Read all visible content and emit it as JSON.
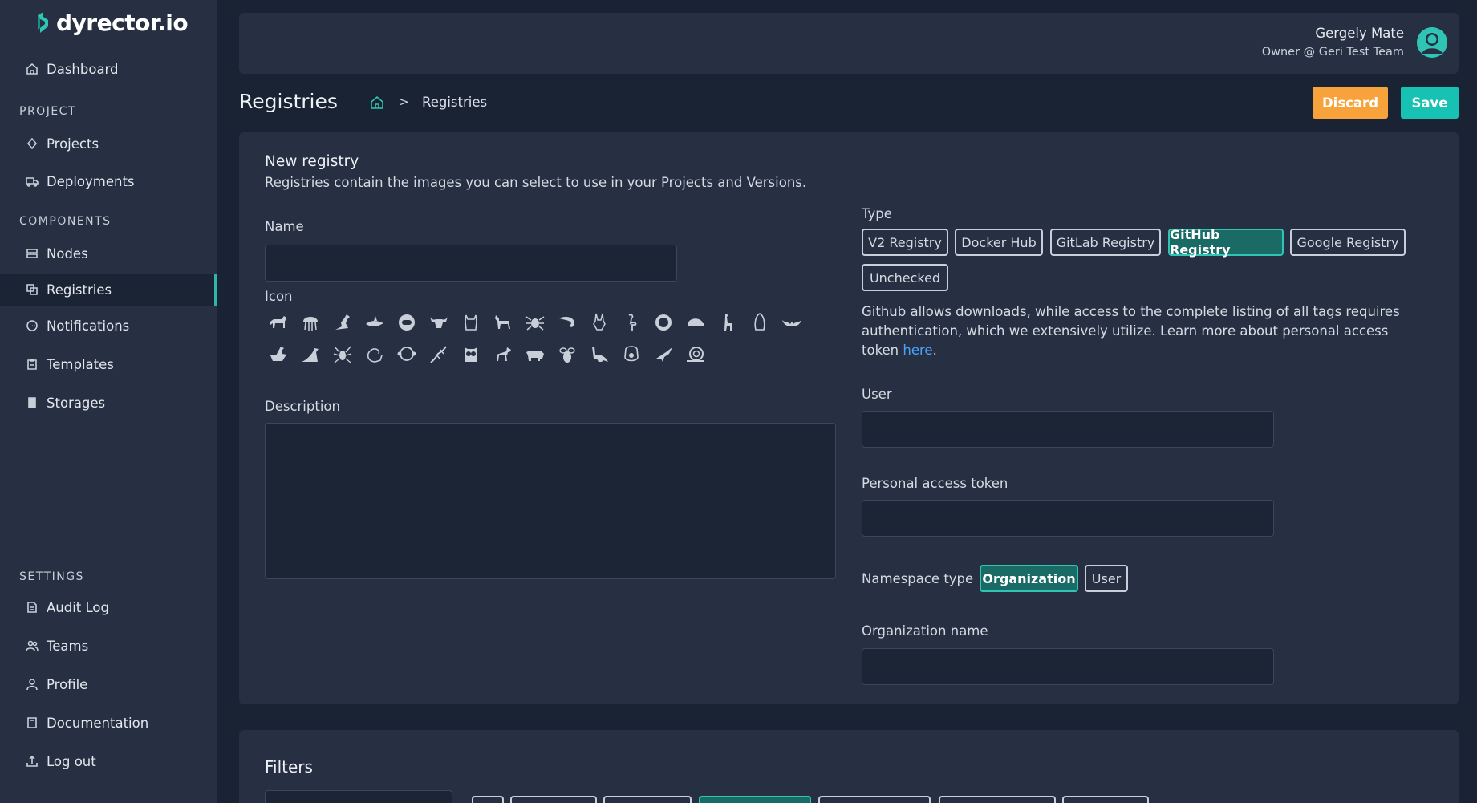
{
  "brand": {
    "name": "dyrector.io"
  },
  "sidebar": {
    "dashboard": "Dashboard",
    "section_project": "PROJECT",
    "projects": "Projects",
    "deployments": "Deployments",
    "section_components": "COMPONENTS",
    "nodes": "Nodes",
    "registries": "Registries",
    "notifications": "Notifications",
    "templates": "Templates",
    "storages": "Storages",
    "section_settings": "SETTINGS",
    "audit_log": "Audit Log",
    "teams": "Teams",
    "profile": "Profile",
    "documentation": "Documentation",
    "log_out": "Log out"
  },
  "user": {
    "name": "Gergely Mate",
    "role": "Owner @ Geri Test Team"
  },
  "page": {
    "title": "Registries",
    "breadcrumb_current": "Registries",
    "breadcrumb_sep": ">",
    "discard": "Discard",
    "save": "Save"
  },
  "form": {
    "heading": "New registry",
    "subheading": "Registries contain the images you can select to use in your Projects and Versions.",
    "name_label": "Name",
    "name_value": "",
    "icon_label": "Icon",
    "description_label": "Description",
    "description_value": "",
    "type_label": "Type",
    "types": [
      "V2 Registry",
      "Docker Hub",
      "GitLab Registry",
      "GitHub Registry",
      "Google Registry",
      "Unchecked"
    ],
    "selected_type": "GitHub Registry",
    "help_text": "Github allows downloads, while access to the complete listing of all tags requires authentication, which we extensively utilize. Learn more about personal access token ",
    "help_link": "here",
    "help_end": ".",
    "user_label": "User",
    "user_value": "",
    "token_label": "Personal access token",
    "token_value": "",
    "namespace_label": "Namespace type",
    "namespace_options": [
      "Organization",
      "User"
    ],
    "namespace_selected": "Organization",
    "org_label": "Organization name",
    "org_value": ""
  },
  "icons": [
    "horse-icon",
    "jellyfish-icon",
    "kangaroo-icon",
    "shark-icon",
    "astronaut-icon",
    "bull-icon",
    "cat-icon",
    "donkey-icon",
    "spider-icon",
    "shrimp-icon",
    "rabbit-icon",
    "flamingo-icon",
    "lion-icon",
    "turtle-icon",
    "giraffe-icon",
    "penguin-icon",
    "bat-icon",
    "duck-icon",
    "seal-icon",
    "spider2-icon",
    "squirrel-icon",
    "monkey-icon",
    "lizard-icon",
    "owl-icon",
    "dog-icon",
    "rhino-icon",
    "bee-icon",
    "dinosaur-icon",
    "gorilla-icon",
    "bird-icon",
    "snail-icon"
  ],
  "filters": {
    "heading": "Filters"
  },
  "colors": {
    "accent": "#17c2b3",
    "discard": "#f7a23a",
    "sidebar": "#263042",
    "background": "#1a2333"
  }
}
